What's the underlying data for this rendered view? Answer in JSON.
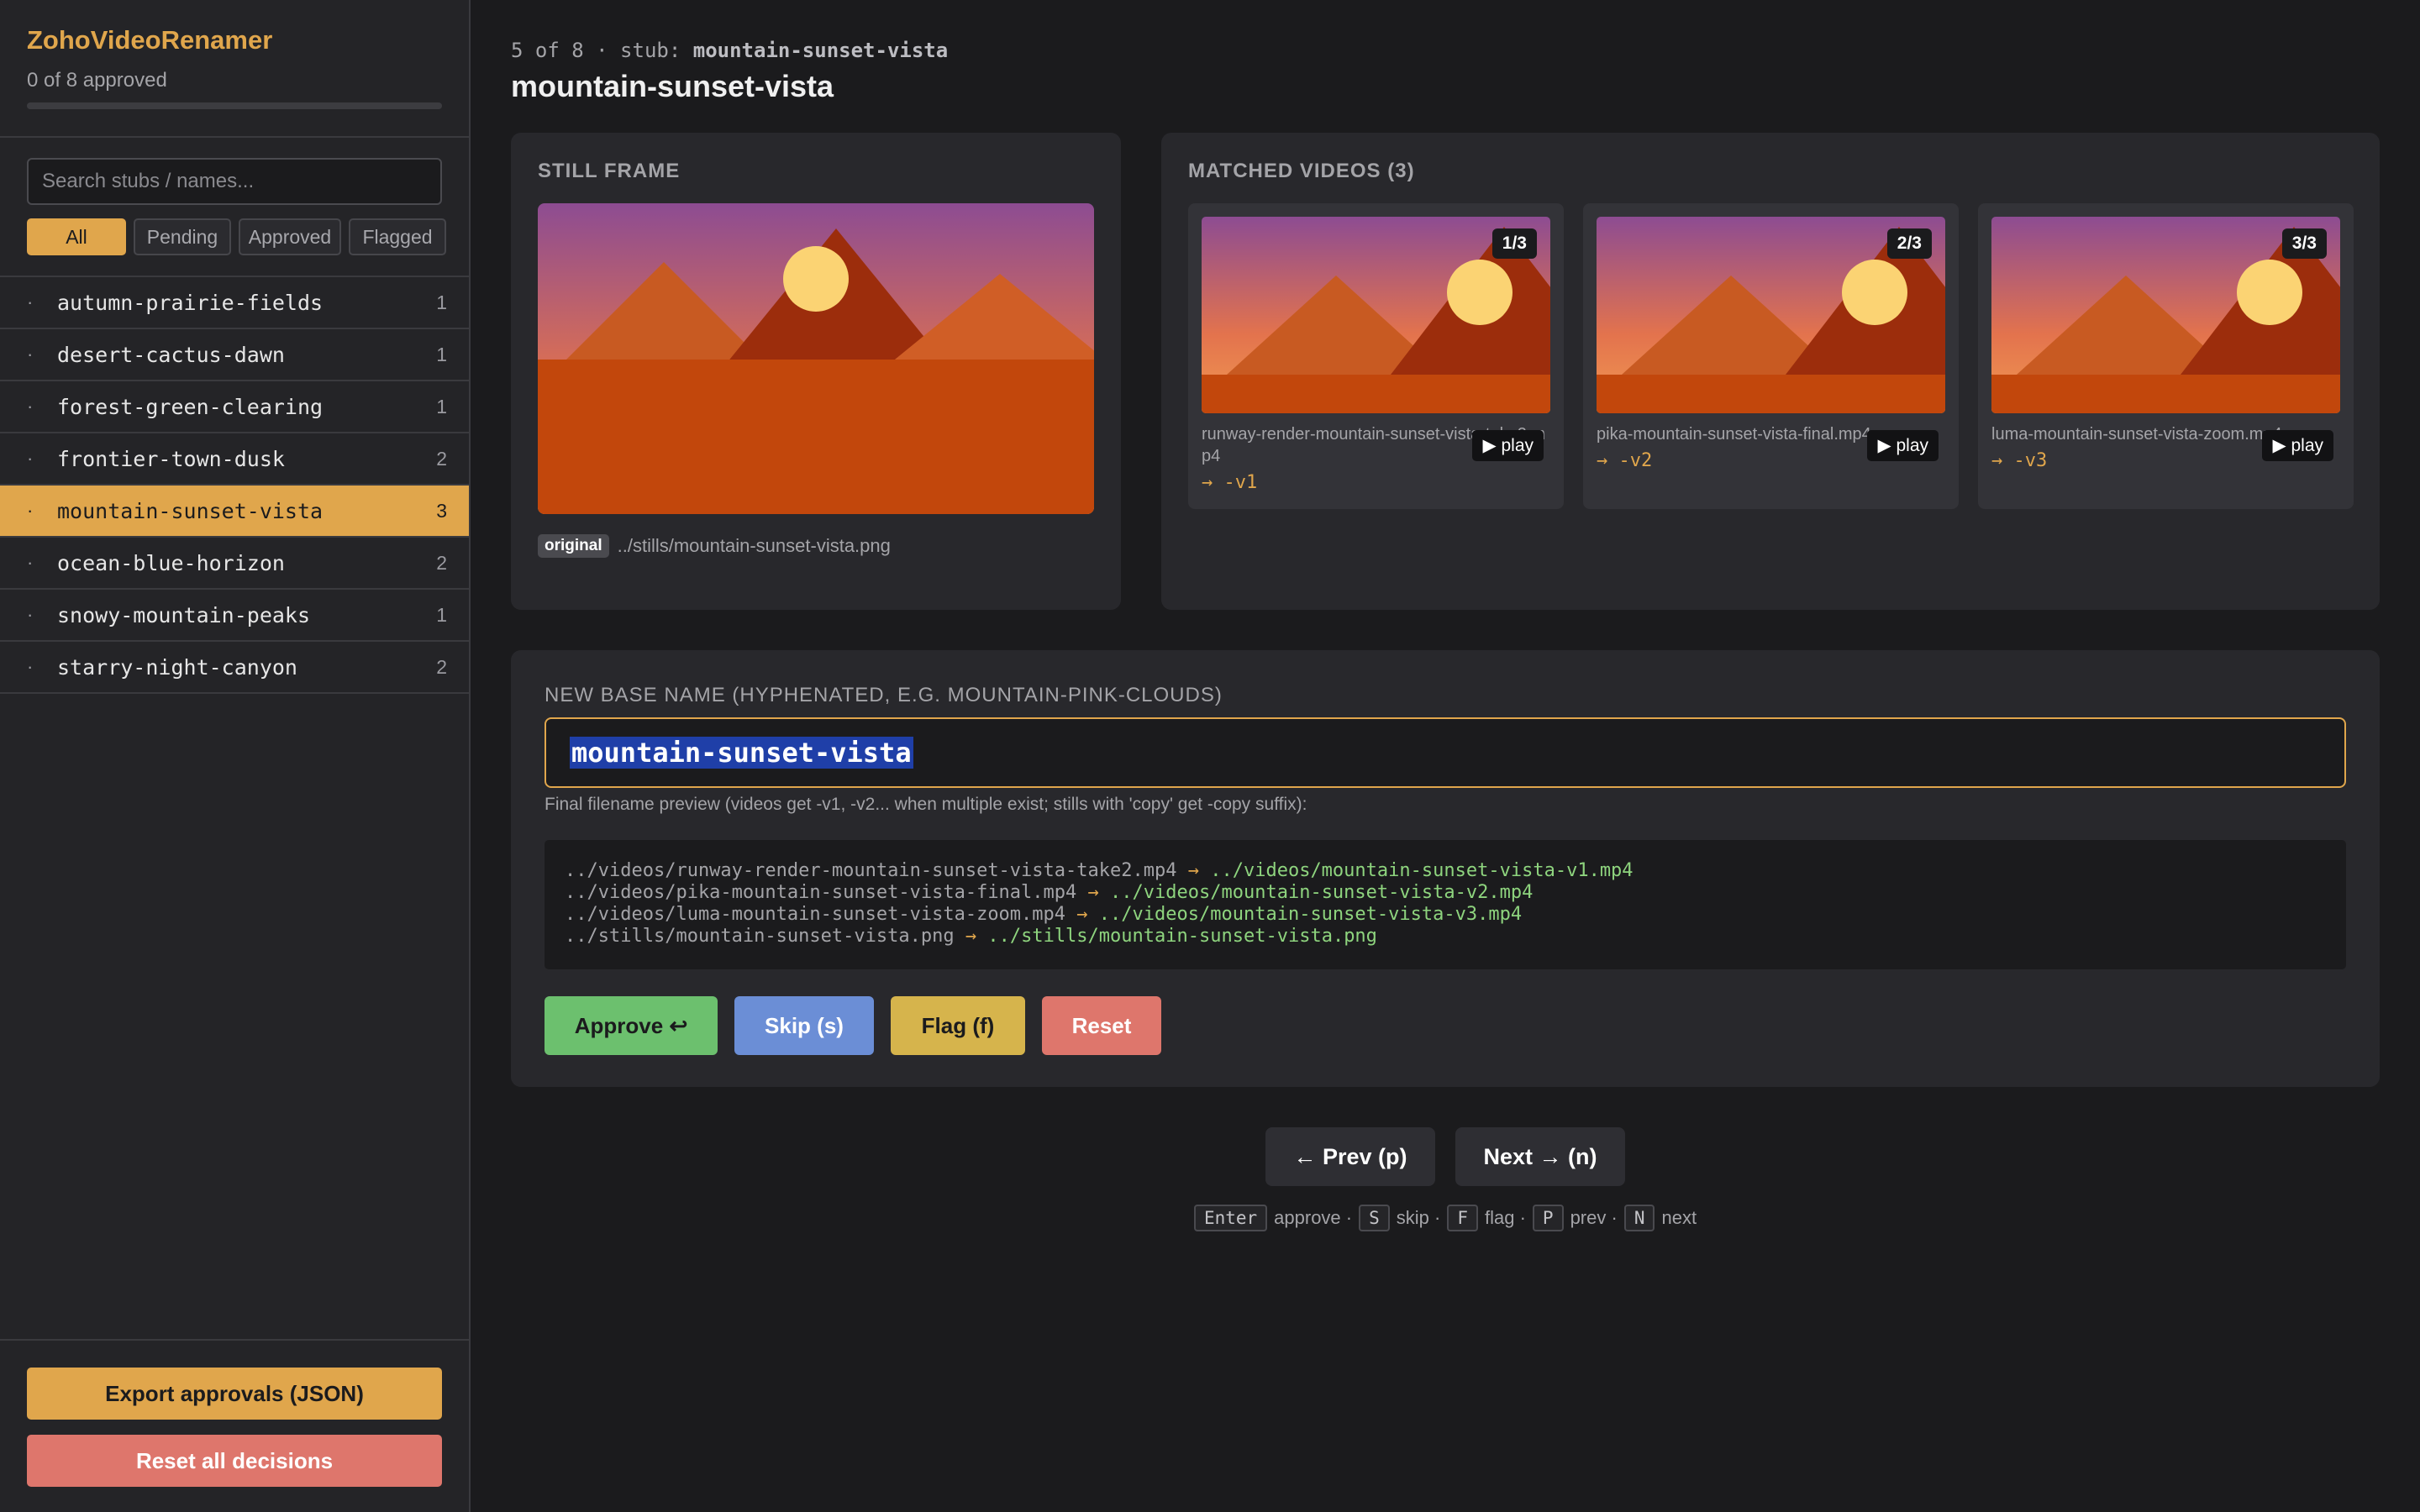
{
  "sidebar": {
    "app_title": "ZohoVideoRenamer",
    "progress_text": "0 of 8 approved",
    "progress_fraction": 0,
    "search": {
      "placeholder": "Search stubs / names...",
      "value": ""
    },
    "filters": [
      {
        "label": "All",
        "active": true
      },
      {
        "label": "Pending",
        "active": false
      },
      {
        "label": "Approved",
        "active": false
      },
      {
        "label": "Flagged",
        "active": false
      }
    ],
    "stubs": [
      {
        "bullet": "·",
        "name": "autumn-prairie-fields",
        "count": "1",
        "active": false
      },
      {
        "bullet": "·",
        "name": "desert-cactus-dawn",
        "count": "1",
        "active": false
      },
      {
        "bullet": "·",
        "name": "forest-green-clearing",
        "count": "1",
        "active": false
      },
      {
        "bullet": "·",
        "name": "frontier-town-dusk",
        "count": "2",
        "active": false
      },
      {
        "bullet": "·",
        "name": "mountain-sunset-vista",
        "count": "3",
        "active": true
      },
      {
        "bullet": "·",
        "name": "ocean-blue-horizon",
        "count": "2",
        "active": false
      },
      {
        "bullet": "·",
        "name": "snowy-mountain-peaks",
        "count": "1",
        "active": false
      },
      {
        "bullet": "·",
        "name": "starry-night-canyon",
        "count": "2",
        "active": false
      }
    ],
    "export_label": "Export approvals (JSON)",
    "reset_all_label": "Reset all decisions"
  },
  "header": {
    "position": "5 of 8 · stub: ",
    "stub": "mountain-sunset-vista",
    "title": "mountain-sunset-vista"
  },
  "still": {
    "title": "STILL FRAME",
    "badge": "original",
    "path": "../stills/mountain-sunset-vista.png"
  },
  "videos": {
    "title": "MATCHED VIDEOS (3)",
    "play_label": "▶ play",
    "items": [
      {
        "index": "1/3",
        "name": "runway-render-mountain-sunset-vista-take2.mp4",
        "suffix": "→ -v1"
      },
      {
        "index": "2/3",
        "name": "pika-mountain-sunset-vista-final.mp4",
        "suffix": "→ -v2"
      },
      {
        "index": "3/3",
        "name": "luma-mountain-sunset-vista-zoom.mp4",
        "suffix": "→ -v3"
      }
    ]
  },
  "rename": {
    "label": "NEW BASE NAME (HYPHENATED, E.G. MOUNTAIN-PINK-CLOUDS)",
    "value": "mountain-sunset-vista",
    "preview_caption": "Final filename preview (videos get -v1, -v2... when multiple exist; stills with 'copy' get -copy suffix):",
    "preview": [
      {
        "old": "../videos/runway-render-mountain-sunset-vista-take2.mp4",
        "arrow": " → ",
        "new": "../videos/mountain-sunset-vista-v1.mp4"
      },
      {
        "old": "../videos/pika-mountain-sunset-vista-final.mp4",
        "arrow": " → ",
        "new": "../videos/mountain-sunset-vista-v2.mp4"
      },
      {
        "old": "../videos/luma-mountain-sunset-vista-zoom.mp4",
        "arrow": " → ",
        "new": "../videos/mountain-sunset-vista-v3.mp4"
      },
      {
        "old": "../stills/mountain-sunset-vista.png",
        "arrow": " → ",
        "new": "../stills/mountain-sunset-vista.png"
      }
    ],
    "actions": {
      "approve": "Approve ↩",
      "skip": "Skip (s)",
      "flag": "Flag (f)",
      "reset": "Reset"
    }
  },
  "navigation": {
    "prev": "← Prev (p)",
    "next": "Next → (n)"
  },
  "shortcuts": [
    {
      "key": "Enter",
      "text": "approve ·"
    },
    {
      "key": "S",
      "text": "skip ·"
    },
    {
      "key": "F",
      "text": "flag ·"
    },
    {
      "key": "P",
      "text": "prev ·"
    },
    {
      "key": "N",
      "text": "next"
    }
  ],
  "colors": {
    "accent": "#e0a64c",
    "approve": "#6cc06e",
    "skip": "#6b8ed6",
    "flag": "#d6b44c",
    "reset": "#de766c",
    "preview_new": "#8ed47e"
  }
}
